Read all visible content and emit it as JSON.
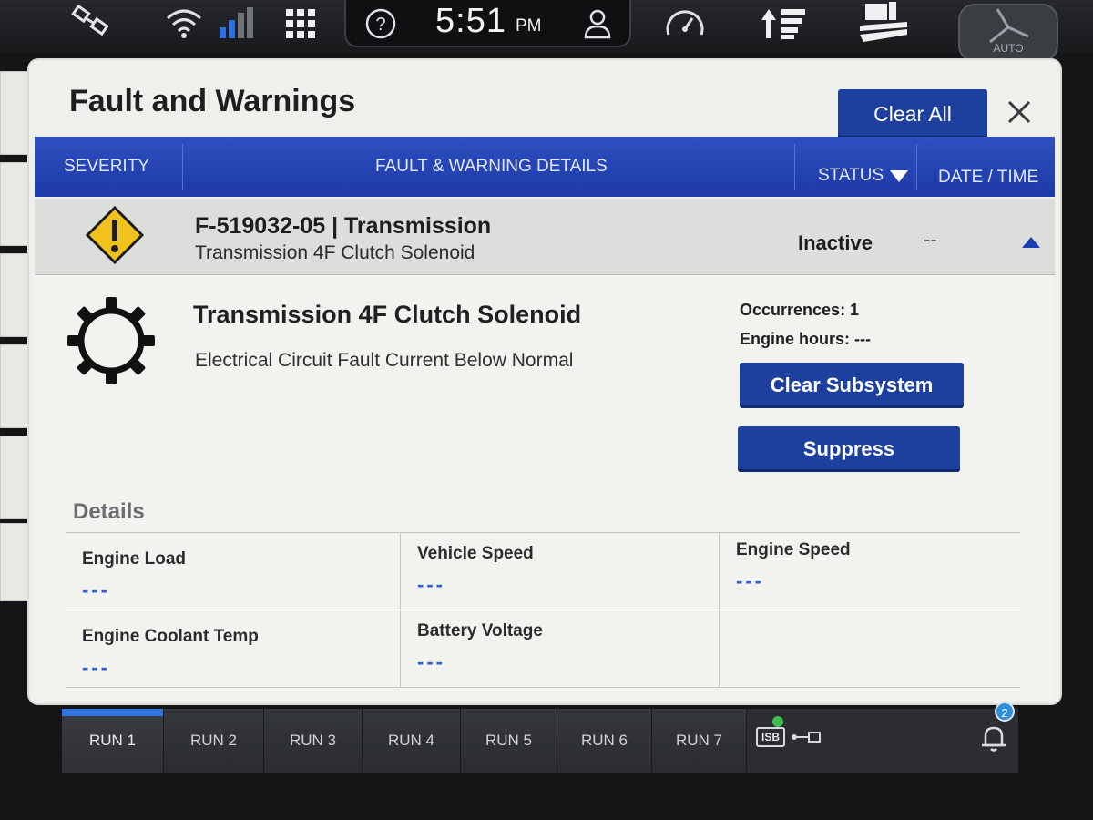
{
  "topbar": {
    "time": "5:51",
    "ampm": "PM",
    "auto_label": "AUTO",
    "icons": [
      "satellite-icon",
      "wifi-icon",
      "signal-icon",
      "apps-grid-icon",
      "help-icon",
      "user-icon",
      "gauge-icon",
      "sort-icon",
      "field-icon",
      "steering-icon"
    ]
  },
  "dialog": {
    "title": "Fault and Warnings",
    "clear_all_label": "Clear All",
    "columns": {
      "severity": "SEVERITY",
      "details": "FAULT & WARNING DETAILS",
      "status": "STATUS",
      "datetime": "DATE / TIME"
    },
    "fault": {
      "code": "F-519032-05 | Transmission",
      "subtitle": "Transmission 4F Clutch Solenoid",
      "status": "Inactive",
      "date": "--",
      "severity_icon": "warning-diamond-icon"
    },
    "detail": {
      "title": "Transmission 4F Clutch Solenoid",
      "description": "Electrical Circuit Fault Current Below Normal",
      "occurrences": "Occurrences: 1",
      "engine_hours": "Engine hours: ---",
      "clear_subsystem_label": "Clear Subsystem",
      "suppress_label": "Suppress",
      "details_label": "Details",
      "cells": [
        {
          "label": "Engine Load",
          "value": "---"
        },
        {
          "label": "Vehicle Speed",
          "value": "---"
        },
        {
          "label": "Engine Speed",
          "value": "---"
        },
        {
          "label": "Engine Coolant Temp",
          "value": "---"
        },
        {
          "label": "Battery Voltage",
          "value": "---"
        }
      ]
    }
  },
  "runbar": {
    "tabs": [
      "RUN 1",
      "RUN 2",
      "RUN 3",
      "RUN 4",
      "RUN 5",
      "RUN 6",
      "RUN 7"
    ],
    "isb_label": "ISB",
    "notification_count": "2"
  },
  "colors": {
    "accent_blue": "#1d3f9e",
    "header_blue": "#2f4fc0",
    "warning_yellow": "#f2c21c",
    "value_blue": "#2f5fd0"
  }
}
